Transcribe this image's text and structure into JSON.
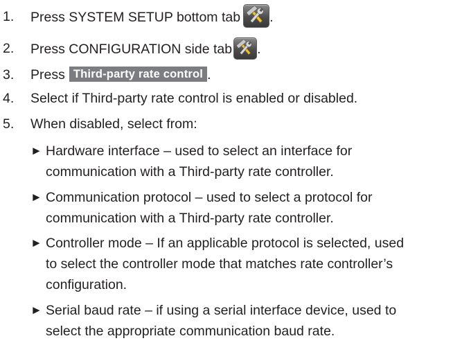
{
  "steps": [
    {
      "num": "1.",
      "text": "Press SYSTEM SETUP bottom tab",
      "after": "."
    },
    {
      "num": "2.",
      "text": "Press CONFIGURATION side tab",
      "after": "."
    },
    {
      "num": "3.",
      "text": "Press",
      "button": "Third-party rate control",
      "after": "."
    },
    {
      "num": "4.",
      "text": "Select if Third-party rate control is enabled or disabled."
    },
    {
      "num": "5.",
      "text": "When disabled, select from:"
    }
  ],
  "bullet_glyph": "►",
  "options": [
    {
      "lines": [
        "Hardware interface – used to select an interface for",
        "communication with a Third-party rate controller."
      ]
    },
    {
      "lines": [
        "Communication protocol – used to select a protocol for",
        "communication with a Third-party rate controller."
      ]
    },
    {
      "lines": [
        "Controller mode – If an applicable protocol is selected, used",
        "to select the controller mode that matches rate controller’s",
        "configuration."
      ]
    },
    {
      "lines": [
        "Serial baud rate – if using a serial interface device, used to",
        "select the appropriate communication baud rate."
      ]
    }
  ],
  "icons": {
    "setup": "hammer-wrench-icon"
  },
  "colors": {
    "text": "#231f20",
    "button_bg": "#7b7d80",
    "icon_bg": "#4d4d4d",
    "tool_yellow": "#f2c230"
  }
}
